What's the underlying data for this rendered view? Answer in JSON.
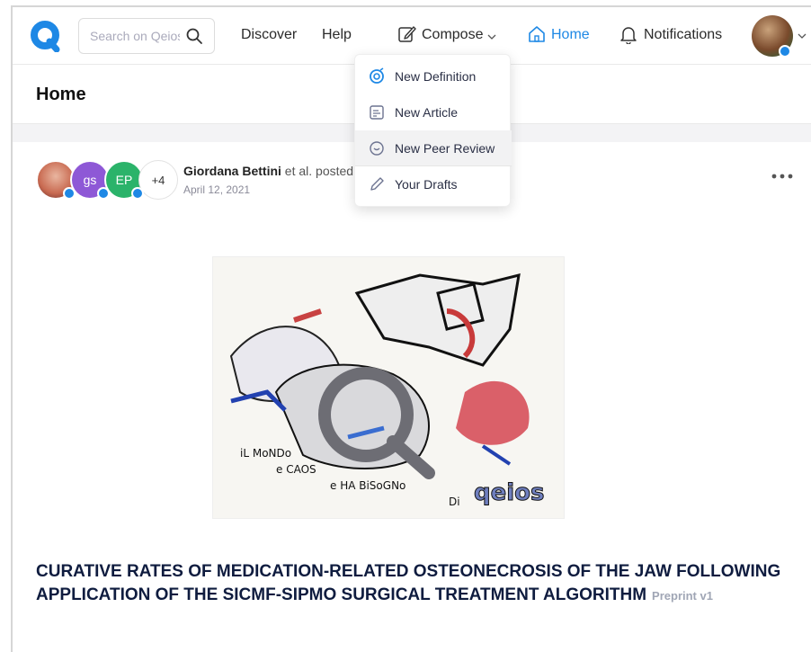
{
  "nav": {
    "search_placeholder": "Search on Qeios",
    "discover": "Discover",
    "help": "Help",
    "compose": "Compose",
    "home": "Home",
    "notifications": "Notifications"
  },
  "compose_menu": {
    "items": [
      {
        "label": "New Definition",
        "icon": "definition-icon"
      },
      {
        "label": "New Article",
        "icon": "article-icon"
      },
      {
        "label": "New Peer Review",
        "icon": "peer-review-icon"
      },
      {
        "label": "Your Drafts",
        "icon": "pencil-icon"
      }
    ]
  },
  "header": {
    "title": "Home"
  },
  "post": {
    "avatars": [
      "",
      "gs",
      "EP",
      "+4"
    ],
    "author": "Giordana Bettini",
    "author_suffix": " et al. posted",
    "date": "April 12, 2021",
    "artwork_text": [
      "iL MoNDo",
      "e CAOS",
      "e HA BiSoGNo",
      "Di",
      "qeios"
    ],
    "title": "CURATIVE RATES OF MEDICATION-RELATED OSTEONECROSIS OF THE JAW FOLLOWING APPLICATION OF THE SICMF-SIPMO SURGICAL TREATMENT ALGORITHM",
    "version": "Preprint v1"
  },
  "colors": {
    "accent": "#1e88e5",
    "title": "#0f1c3f",
    "muted": "#8a8a98"
  }
}
